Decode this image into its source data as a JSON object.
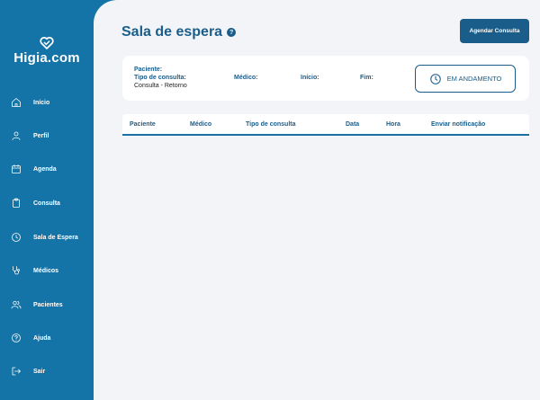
{
  "sidebar": {
    "brand": "Higia.com",
    "items": [
      {
        "label": "Início",
        "icon": "home-icon"
      },
      {
        "label": "Perfil",
        "icon": "user-icon"
      },
      {
        "label": "Agenda",
        "icon": "calendar-icon"
      },
      {
        "label": "Consulta",
        "icon": "clipboard-icon"
      },
      {
        "label": "Sala de Espera",
        "icon": "clock-icon"
      },
      {
        "label": "Médicos",
        "icon": "stethoscope-icon"
      },
      {
        "label": "Pacientes",
        "icon": "users-icon"
      },
      {
        "label": "Ajuda",
        "icon": "help-circle-icon"
      },
      {
        "label": "Sair",
        "icon": "logout-icon"
      }
    ]
  },
  "header": {
    "title": "Sala de espera",
    "help_icon": "?",
    "action_label": "Agendar Consulta"
  },
  "card": {
    "paciente_label": "Paciente:",
    "tipo_label": "Tipo de consulta:",
    "tipo_value": "Consulta - Retorno",
    "medico_label": "Médico:",
    "inicio_label": "Início:",
    "fim_label": "Fim:",
    "status_label": "EM ANDAMENTO"
  },
  "table": {
    "columns": [
      "Paciente",
      "Médico",
      "Tipo de consulta",
      "Data",
      "Hora",
      "Enviar notificação"
    ]
  },
  "colors": {
    "sidebar": "#1473a7",
    "accent": "#1a5d8a",
    "background": "#f2f4f7"
  }
}
